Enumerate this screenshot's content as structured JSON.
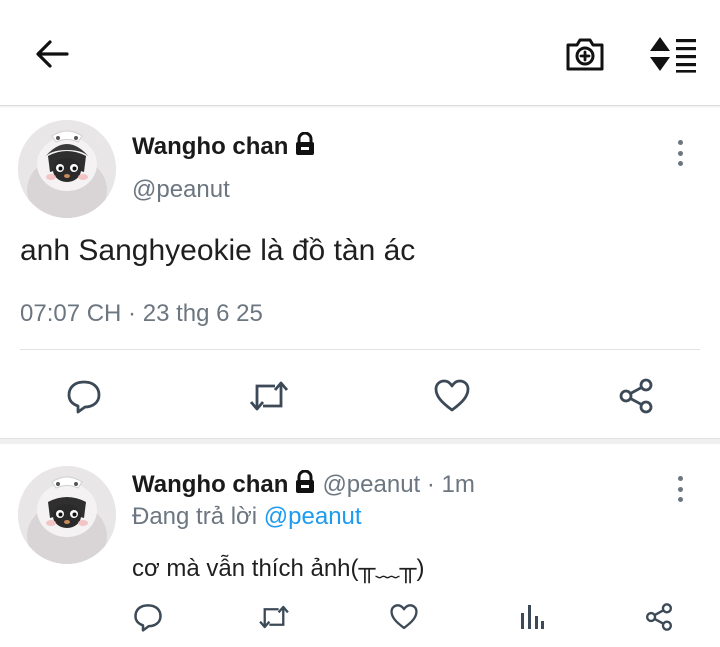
{
  "header": {
    "back_icon": "arrow-left-icon",
    "camera_icon": "camera-plus-icon",
    "sort_icon": "sort-list-icon"
  },
  "tweet": {
    "avatar": "penguin-avatar",
    "name": "Wangho chan",
    "protected_icon": "lock-icon",
    "handle": "@peanut",
    "text": "anh Sanghyeokie là đồ tàn ác",
    "meta": "07:07 CH · 23 thg 6 25",
    "actions": [
      "reply-icon",
      "retweet-icon",
      "like-icon",
      "share-icon"
    ]
  },
  "reply": {
    "avatar": "penguin-avatar",
    "name": "Wangho chan",
    "protected_icon": "lock-icon",
    "handle_time": "@peanut · 1m",
    "replying_prefix": "Đang trả lời",
    "replying_to": "@peanut",
    "text": "cơ mà vẫn thích ảnh(╥﹏╥)",
    "actions": [
      "reply-icon",
      "retweet-icon",
      "like-icon",
      "analytics-icon",
      "share-icon"
    ]
  },
  "colors": {
    "link": "#1d9bf0",
    "muted": "#6b7680",
    "icon": "#3c4a57"
  }
}
